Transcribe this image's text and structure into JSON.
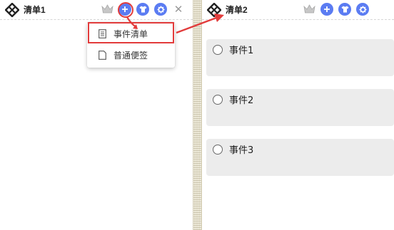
{
  "left_window": {
    "title": "清单1",
    "menu": {
      "items": [
        {
          "label": "事件清单",
          "icon": "list-doc-icon"
        },
        {
          "label": "普通便签",
          "icon": "note-doc-icon"
        }
      ]
    }
  },
  "right_window": {
    "title": "清单2",
    "events": [
      {
        "label": "事件1"
      },
      {
        "label": "事件2"
      },
      {
        "label": "事件3"
      }
    ]
  },
  "colors": {
    "accent_blue": "#5b7cf2",
    "highlight_red": "#e23b3b",
    "card_bg": "#ececec"
  },
  "icons": [
    "app-logo-icon",
    "crown-icon",
    "plus-icon",
    "shirt-icon",
    "gear-icon",
    "close-icon"
  ]
}
